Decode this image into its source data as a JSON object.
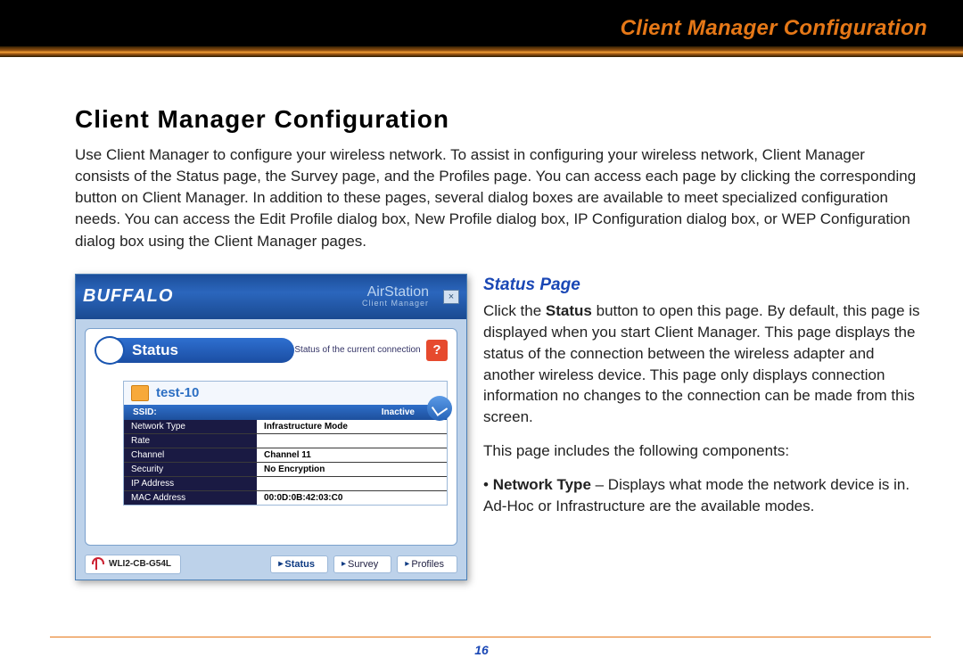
{
  "doc": {
    "header_title": "Client Manager Configuration",
    "heading": "Client Manager Configuration",
    "intro": "Use Client Manager to configure your wireless network. To assist in configuring your wireless network, Client Manager consists of the Status page, the Survey page, and the Profiles page. You can access each page by clicking the corresponding button on Client Manager. In addition to these pages, several dialog boxes are available to meet specialized configuration needs. You can access the Edit Profile dialog box, New Profile dialog box, IP Configuration dialog box, or WEP Configuration dialog box using the Client Manager pages.",
    "sub_heading": "Status Page",
    "status_p1a": "Click the ",
    "status_bold": "Status",
    "status_p1b": " button to open this page. By default, this page is displayed when you start Client Manager. This page displays the status of the connection between the wireless adapter and another wireless device. This page only displays connection information no changes to the connection can be made from this screen.",
    "status_p2": "This page includes the following components:",
    "bullet_prefix": "• ",
    "bullet_bold": "Network Type",
    "bullet_rest": " – Displays what mode the network device is in.  Ad-Hoc or Infrastructure are the available modes.",
    "page_number": "16"
  },
  "app": {
    "brand": "BUFFALO",
    "product": "AirStation",
    "product_sub": "Client Manager",
    "status_label": "Status",
    "status_sub": "Status of the current connection",
    "ssid_name": "test-10",
    "ssid_key": "SSID:",
    "ssid_state": "Inactive",
    "details": [
      {
        "k": "Network Type",
        "v": "Infrastructure Mode"
      },
      {
        "k": "Rate",
        "v": ""
      },
      {
        "k": "Channel",
        "v": "Channel 11"
      },
      {
        "k": "Security",
        "v": "No Encryption"
      },
      {
        "k": "IP Address",
        "v": ""
      },
      {
        "k": "MAC Address",
        "v": "00:0D:0B:42:03:C0"
      }
    ],
    "adapter": "WLI2-CB-G54L",
    "tabs": [
      "Status",
      "Survey",
      "Profiles"
    ]
  }
}
